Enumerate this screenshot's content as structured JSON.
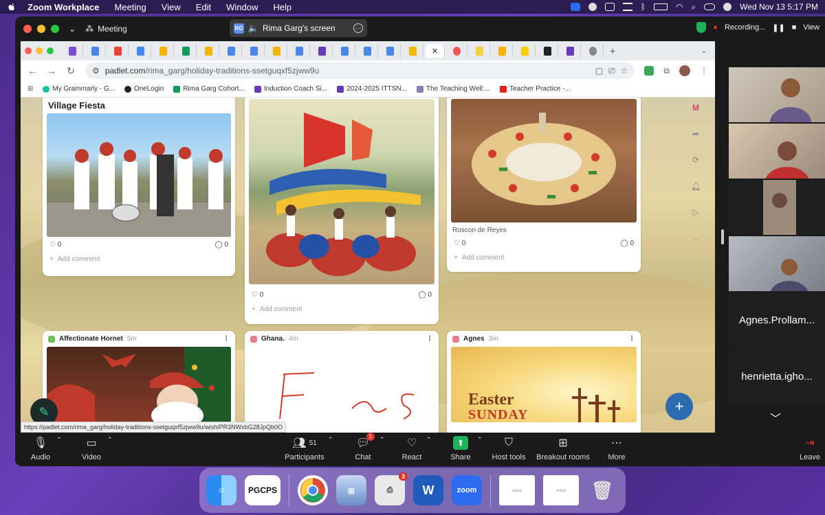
{
  "menubar": {
    "app": "Zoom Workplace",
    "items": [
      "Meeting",
      "View",
      "Edit",
      "Window",
      "Help"
    ],
    "datetime": "Wed Nov 13  5:17 PM"
  },
  "zoom": {
    "title": "Meeting",
    "screen_share_label": "Rima Garg's screen",
    "screen_share_initials": "RG",
    "recording": "Recording...",
    "view": "View"
  },
  "browser": {
    "url_host": "padlet.com",
    "url_path": "/rima_garg/holiday-traditions-ssetguqxf5zjww9u",
    "bookmarks": [
      "My Grammarly - G...",
      "OneLogin",
      "Rima Garg Cohort...",
      "Induction Coach Si...",
      "2024-2025 ITTSN...",
      "The Teaching Well:...",
      "Teacher Practice -..."
    ],
    "status_url": "https://padlet.com/rima_garg/holiday-traditions-ssetguqxf5zjww9u/wish/PR3NWxbG28JpQb0O"
  },
  "padlet": {
    "cards": [
      {
        "title": "Village Fiesta",
        "likes": "0",
        "comments": "0",
        "add_comment": "Add comment"
      },
      {
        "likes": "0",
        "comments": "0",
        "add_comment": "Add comment"
      },
      {
        "caption": "Roscon de Reyes",
        "likes": "0",
        "comments": "0",
        "add_comment": "Add comment"
      },
      {
        "author": "Affectionate Hornet",
        "time": "5m"
      },
      {
        "author": "Ghana.",
        "time": "4m",
        "handwriting": "F   s"
      },
      {
        "author": "Agnes",
        "time": "3m",
        "image_text1": "Easter",
        "image_text2": "SUNDAY"
      }
    ]
  },
  "gallery": {
    "names": [
      "Agnes.Prollam...",
      "henrietta.igho..."
    ]
  },
  "toolbar": {
    "audio": "Audio",
    "video": "Video",
    "participants": "Participants",
    "participants_count": "51",
    "chat": "Chat",
    "chat_badge": "1",
    "react": "React",
    "share": "Share",
    "host_tools": "Host tools",
    "breakout": "Breakout rooms",
    "more": "More",
    "leave": "Leave"
  },
  "dock": {
    "pgcps": "PGCPS",
    "zoom": "zoom",
    "badge": "3",
    "word": "W"
  }
}
